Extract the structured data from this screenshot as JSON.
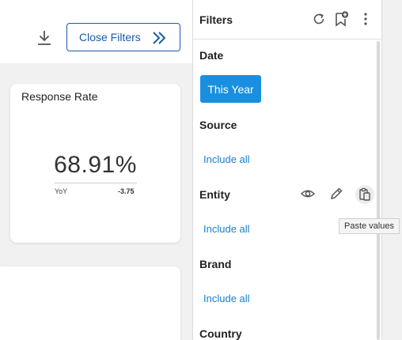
{
  "toolbar": {
    "download_icon": "download-icon",
    "close_filters_label": "Close Filters",
    "close_filters_icon": "double-chevron-right-icon",
    "accent_color": "#1a5aa8"
  },
  "card": {
    "title": "Response Rate",
    "value": "68.91%",
    "yoy_label": "YoY",
    "yoy_value": "-3.75"
  },
  "filters": {
    "title": "Filters",
    "header_icons": [
      "reset-icon",
      "bookmark-add-icon",
      "more-vert-icon"
    ],
    "sections": [
      {
        "label": "Date",
        "value": "This Year"
      },
      {
        "label": "Source",
        "value": "Include all"
      },
      {
        "label": "Entity",
        "value": "Include all",
        "icons": [
          "eye-icon",
          "pencil-icon",
          "paste-icon"
        ]
      },
      {
        "label": "Brand",
        "value": "Include all"
      },
      {
        "label": "Country"
      }
    ],
    "selected_color": "#1a8fe0",
    "link_color": "#1a7fd0"
  },
  "tooltip": {
    "text": "Paste values"
  }
}
